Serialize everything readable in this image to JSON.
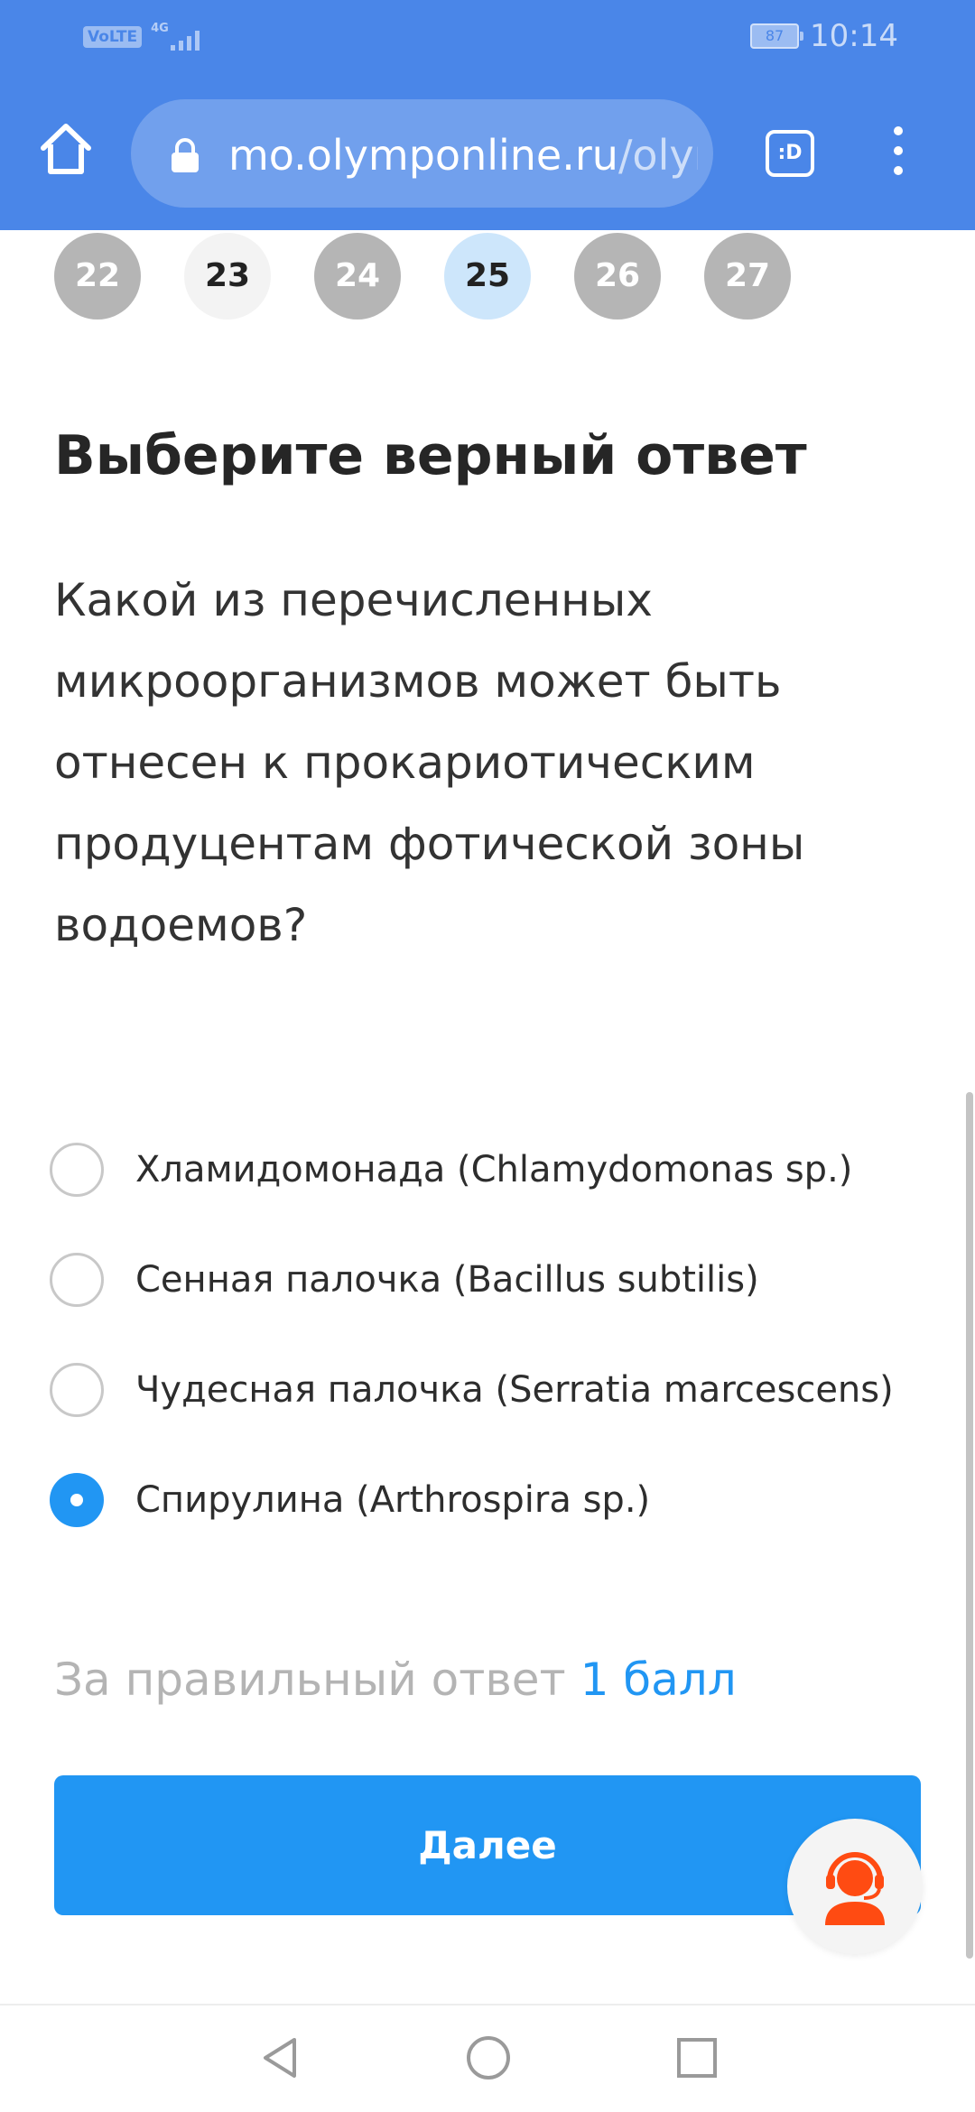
{
  "status_bar": {
    "network_type": "VoLTE",
    "signal_gen": "4G",
    "battery": "87",
    "time": "10:14"
  },
  "browser": {
    "url_domain": "mo.olymponline.ru",
    "url_path": "/olym",
    "tab_label": ":D",
    "icons": [
      "home-icon",
      "lock-icon",
      "tab-switcher-icon",
      "more-vert-icon"
    ]
  },
  "question_nav": {
    "numbers": [
      "22",
      "23",
      "24",
      "25",
      "26",
      "27"
    ],
    "current": "25"
  },
  "quiz": {
    "heading": "Выберите верный ответ",
    "question": "Какой из перечисленных микроорганизмов может быть отнесен к прокариотическим продуцентам фотической зоны водоемов?",
    "options": [
      {
        "label": "Хламидомонада (Chlamydomonas sp.)",
        "selected": false
      },
      {
        "label": "Сенная палочка (Bacillus subtilis)",
        "selected": false
      },
      {
        "label": "Чудесная палочка (Serratia marcescens)",
        "selected": false
      },
      {
        "label": "Спирулина (Arthrospira sp.)",
        "selected": true
      }
    ],
    "points_label": "За правильный ответ",
    "points_value": "1 балл",
    "next_label": "Далее"
  },
  "colors": {
    "chrome_blue": "#4a86e8",
    "accent_blue": "#2196f3",
    "support_orange": "#ff4b12"
  },
  "system_nav": {
    "icons": [
      "back-icon",
      "home-circle-icon",
      "recents-icon"
    ]
  }
}
